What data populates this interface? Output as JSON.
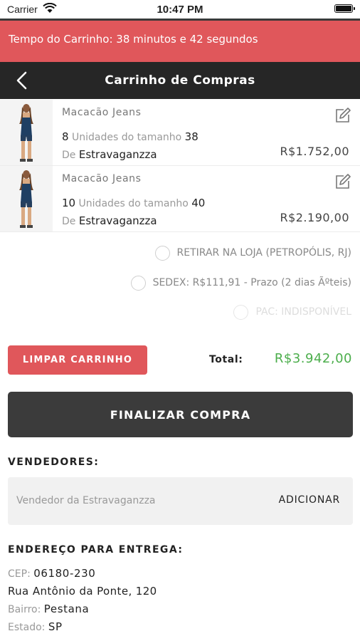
{
  "status_bar": {
    "carrier": "Carrier",
    "time": "10:47 PM"
  },
  "timer": {
    "text": "Tempo do Carrinho: 38 minutos e 42 segundos"
  },
  "nav": {
    "title": "Carrinho de Compras"
  },
  "cart": {
    "items": [
      {
        "name": "Macacão Jeans",
        "qty": "8",
        "units_label": "Unidades do tamanho",
        "size": "38",
        "from_label": "De",
        "seller": "Estravaganzza",
        "price": "R$1.752,00"
      },
      {
        "name": "Macacão Jeans",
        "qty": "10",
        "units_label": "Unidades do tamanho",
        "size": "40",
        "from_label": "De",
        "seller": "Estravaganzza",
        "price": "R$2.190,00"
      }
    ]
  },
  "shipping": {
    "options": [
      {
        "label": "RETIRAR NA LOJA (PETROPÓLIS, RJ)",
        "enabled": true
      },
      {
        "label": "SEDEX: R$111,91 - Prazo (2 dias Ãºteis)",
        "enabled": true
      },
      {
        "label": "PAC: INDISPONÍVEL",
        "enabled": false
      }
    ]
  },
  "actions": {
    "clear_label": "LIMPAR CARRINHO",
    "total_label": "Total:",
    "total_value": "R$3.942,00",
    "finalize_label": "FINALIZAR COMPRA"
  },
  "sellers": {
    "title": "VENDEDORES:",
    "placeholder": "Vendedor da Estravaganzza",
    "add_label": "ADICIONAR"
  },
  "address": {
    "title": "ENDEREÇO PARA ENTREGA:",
    "cep_label": "CEP:",
    "cep": "06180-230",
    "street": "Rua Antônio da Ponte, 120",
    "bairro_label": "Bairro:",
    "bairro": "Pestana",
    "estado_label": "Estado:",
    "estado": "SP"
  },
  "colors": {
    "accent_red": "#e0575b",
    "nav_dark": "#262626",
    "button_dark": "#3b3b3b",
    "total_green": "#4cae4c"
  },
  "icons": {
    "back": "chevron-left-icon",
    "edit": "edit-icon",
    "wifi": "wifi-icon",
    "battery": "battery-icon"
  }
}
